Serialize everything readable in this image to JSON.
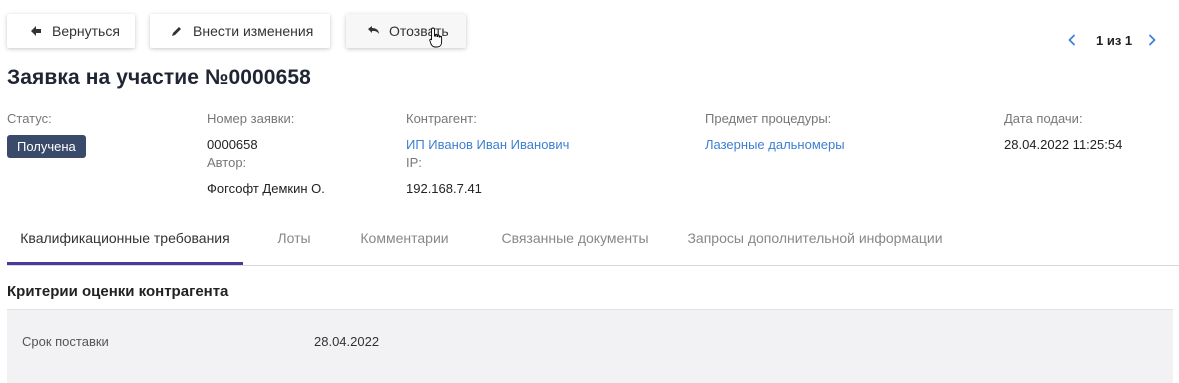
{
  "toolbar": {
    "back_label": "Вернуться",
    "edit_label": "Внести изменения",
    "revoke_label": "Отозвать"
  },
  "pager": {
    "text": "1 из 1"
  },
  "title": "Заявка на участие №0000658",
  "info": {
    "status_label": "Статус:",
    "status_value": "Получена",
    "number_label": "Номер заявки:",
    "number_value": "0000658",
    "author_label": "Автор:",
    "author_value": "Фогсофт Демкин О.",
    "counterparty_label": "Контрагент:",
    "counterparty_value": "ИП Иванов Иван Иванович",
    "ip_label": "IP:",
    "ip_value": "192.168.7.41",
    "subject_label": "Предмет процедуры:",
    "subject_value": "Лазерные дальномеры",
    "date_label": "Дата подачи:",
    "date_value": "28.04.2022 11:25:54"
  },
  "tabs": [
    {
      "label": "Квалификационные требования"
    },
    {
      "label": "Лоты"
    },
    {
      "label": "Комментарии"
    },
    {
      "label": "Связанные документы"
    },
    {
      "label": "Запросы дополнительной информации"
    }
  ],
  "section": {
    "title": "Критерии оценки контрагента",
    "rows": [
      {
        "label": "Срок поставки",
        "value": "28.04.2022"
      }
    ]
  },
  "colors": {
    "accent": "#4b3a9a",
    "link": "#3d7fd0",
    "badge": "#3a4a6b"
  }
}
